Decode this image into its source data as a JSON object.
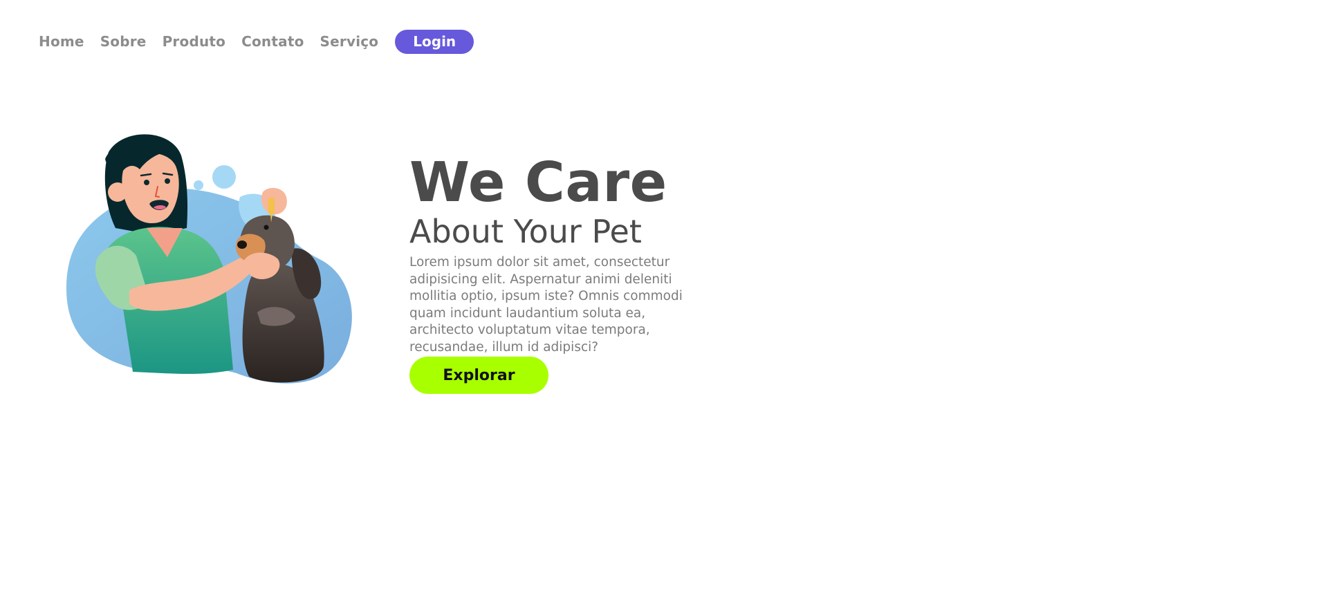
{
  "nav": {
    "items": [
      {
        "label": "Home"
      },
      {
        "label": "Sobre"
      },
      {
        "label": "Produto"
      },
      {
        "label": "Contato"
      },
      {
        "label": "Serviço"
      }
    ],
    "login_label": "Login"
  },
  "hero": {
    "headline": "We Care",
    "subheadline": "About Your Pet",
    "body": "Lorem ipsum dolor sit amet, consectetur adipisicing elit. Aspernatur animi deleniti mollitia optio, ipsum iste? Omnis commodi quam incidunt laudantium soluta ea, architecto voluptatum vitae tempora, recusandae, illum id adipisci?",
    "cta_label": "Explorar"
  },
  "colors": {
    "accent": "#6659db",
    "cta": "#a8ff00",
    "heading": "#4b4b4b",
    "nav_text": "#8c8c8c"
  }
}
